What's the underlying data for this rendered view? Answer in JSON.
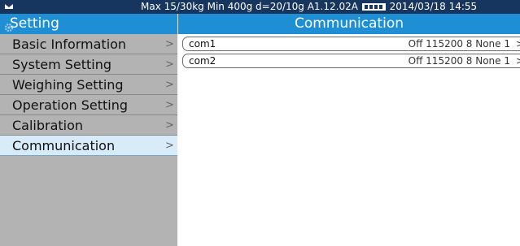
{
  "statusbar": {
    "logo_icon": "device-logo-icon",
    "info_text": "Max 15/30kg  Min 400g  d=20/10g   A1.12.02A",
    "battery_icon": "battery-icon",
    "datetime": "2014/03/18  14:55"
  },
  "sidebar": {
    "title": "Setting",
    "title_icon": "gear-icon",
    "items": [
      {
        "label": "Basic Information",
        "chevron": ">"
      },
      {
        "label": "System Setting",
        "chevron": ">"
      },
      {
        "label": "Weighing Setting",
        "chevron": ">"
      },
      {
        "label": "Operation Setting",
        "chevron": ">"
      },
      {
        "label": "Calibration",
        "chevron": ">"
      },
      {
        "label": "Communication",
        "chevron": ">"
      }
    ],
    "selected": "Communication"
  },
  "main": {
    "title": "Communication",
    "ports": [
      {
        "name": "com1",
        "settings": "Off 115200 8 None 1",
        "chevron": ">"
      },
      {
        "name": "com2",
        "settings": "Off 115200 8 None 1",
        "chevron": ">"
      }
    ]
  },
  "colors": {
    "statusbar_bg": "#17365f",
    "header_bg": "#1e8fd4",
    "sidebar_bg": "#b3b3b3",
    "selected_bg": "#d7ebf8"
  }
}
